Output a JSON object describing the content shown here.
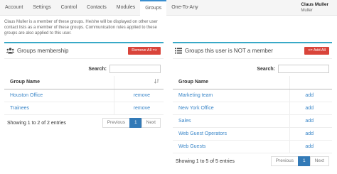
{
  "nav": {
    "tabs": [
      "Account",
      "Settings",
      "Control",
      "Contacts",
      "Modules",
      "Groups",
      "One-To-Any"
    ],
    "active_tab": "Groups",
    "user_name": "Claus Muller",
    "user_sub": "Muller"
  },
  "intro": "Claus Muller is a member of these groups. He/she will be displayed on other user contact lists as a member of these groups. Communication rules applied to these groups are also applied to this user.",
  "membership": {
    "title": "Groups membership",
    "button": "Remove All =>",
    "search_label": "Search:",
    "search_value": "",
    "column_name": "Group Name",
    "rows": [
      {
        "name": "Houston Office",
        "action": "remove"
      },
      {
        "name": "Trainees",
        "action": "remove"
      }
    ],
    "info": "Showing 1 to 2 of 2 entries",
    "pager": {
      "prev": "Previous",
      "page": "1",
      "next": "Next"
    }
  },
  "not_member": {
    "title": "Groups this user is NOT a member",
    "button": "<= Add All",
    "search_label": "Search:",
    "search_value": "",
    "column_name": "Group Name",
    "rows": [
      {
        "name": "Marketing team",
        "action": "add"
      },
      {
        "name": "New York Office",
        "action": "add"
      },
      {
        "name": "Sales",
        "action": "add"
      },
      {
        "name": "Web Guest Operators",
        "action": "add"
      },
      {
        "name": "Web Guests",
        "action": "add"
      }
    ],
    "info": "Showing 1 to 5 of 5 entries",
    "pager": {
      "prev": "Previous",
      "page": "1",
      "next": "Next"
    }
  },
  "colors": {
    "accent": "#39a9c7",
    "danger": "#d9443a",
    "link": "#3a86c8",
    "page_active": "#337ab7"
  },
  "icons": {
    "membership": "users-icon",
    "not_member": "list-icon",
    "sort": "sort-icon"
  }
}
